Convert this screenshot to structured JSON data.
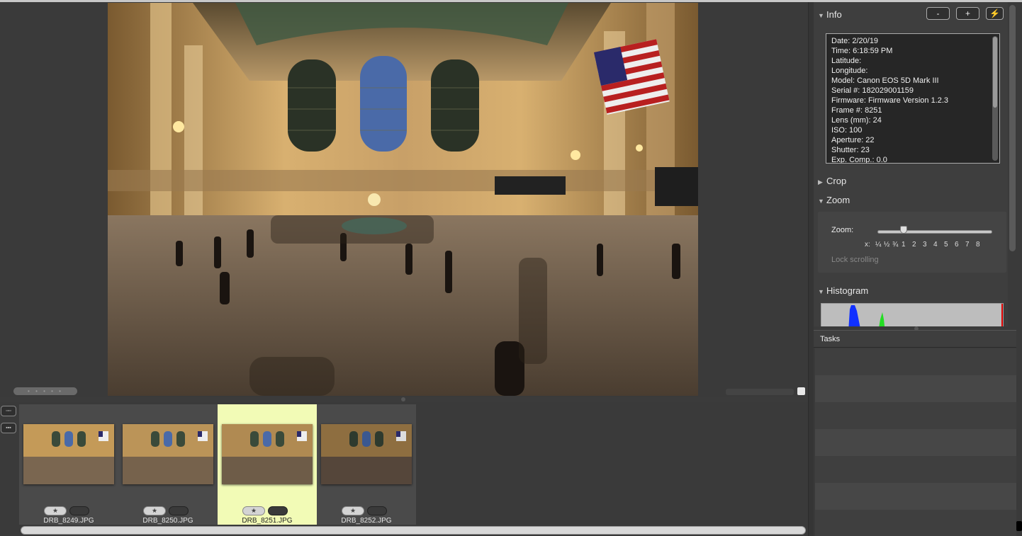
{
  "colors": {
    "selection": "#f2fbb6",
    "histogram_blue": "#1030ff",
    "histogram_green": "#22dd22",
    "histogram_red": "#dd0000"
  },
  "viewer": {
    "handle_glyph": "• • • • •"
  },
  "filmstrip": {
    "view_button_1": "▫▫▫",
    "view_button_2": "▪▪▪",
    "star_glyph": "★",
    "thumbs": [
      {
        "label": "DRB_8249.JPG",
        "selected": false
      },
      {
        "label": "DRB_8250.JPG",
        "selected": false
      },
      {
        "label": "DRB_8251.JPG",
        "selected": true
      },
      {
        "label": "DRB_8252.JPG",
        "selected": false
      }
    ]
  },
  "inspector": {
    "info": {
      "title": "Info",
      "minus_button": "-",
      "plus_button": "+",
      "lightning_button": "⚡",
      "lines": [
        "Date: 2/20/19",
        "Time: 6:18:59 PM",
        "Latitude:",
        "Longitude:",
        "Model: Canon EOS 5D Mark III",
        "Serial #: 182029001159",
        "Firmware: Firmware Version 1.2.3",
        "Frame #: 8251",
        "Lens (mm): 24",
        "ISO: 100",
        "Aperture: 22",
        "Shutter: 23",
        "Exp. Comp.: 0.0"
      ]
    },
    "crop": {
      "title": "Crop"
    },
    "zoom": {
      "title": "Zoom",
      "label": "Zoom:",
      "ticks": [
        "x:",
        "¼",
        "½",
        "¾",
        "1",
        "2",
        "3",
        "4",
        "5",
        "6",
        "7",
        "8"
      ],
      "value": "1",
      "lock_label": "Lock scrolling"
    },
    "histogram": {
      "title": "Histogram"
    }
  },
  "tasks": {
    "title": "Tasks",
    "rows": 7
  }
}
